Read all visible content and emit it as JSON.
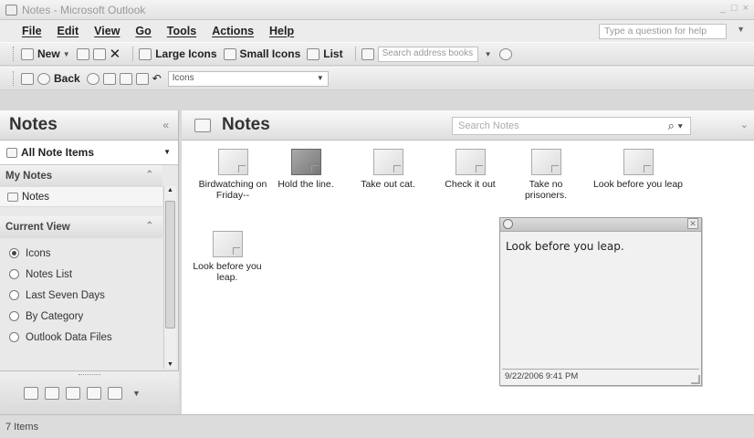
{
  "window": {
    "title": "Notes - Microsoft Outlook"
  },
  "menu": {
    "items": [
      "File",
      "Edit",
      "View",
      "Go",
      "Tools",
      "Actions",
      "Help"
    ],
    "help_placeholder": "Type a question for help"
  },
  "toolbar1": {
    "new_label": "New",
    "large_icons": "Large Icons",
    "small_icons": "Small Icons",
    "list": "List",
    "address_placeholder": "Search address books"
  },
  "toolbar2": {
    "back_label": "Back",
    "view_combo": "Icons"
  },
  "nav": {
    "title": "Notes",
    "all_items": "All Note Items",
    "my_notes_header": "My Notes",
    "my_notes_item": "Notes",
    "current_view_header": "Current View",
    "views": [
      "Icons",
      "Notes List",
      "Last Seven Days",
      "By Category",
      "Outlook Data Files"
    ],
    "selected_view": "Icons"
  },
  "main": {
    "title": "Notes",
    "search_placeholder": "Search Notes",
    "notes": [
      "Birdwatching on Friday--",
      "Hold the line.",
      "Take out cat.",
      "Check it out",
      "Take no prisoners.",
      "Look before you leap",
      "Look before you leap."
    ]
  },
  "open_note": {
    "text": "Look before you leap.",
    "timestamp": "9/22/2006 9:41 PM"
  },
  "status": {
    "text": "7 Items"
  }
}
